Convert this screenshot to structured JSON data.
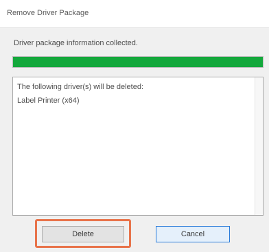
{
  "window": {
    "title": "Remove Driver Package"
  },
  "status": {
    "label": "Driver package information collected.",
    "progress_percent": 100,
    "progress_color": "#14a83c"
  },
  "list": {
    "lines": [
      "The following driver(s) will be deleted:",
      "Label Printer (x64)"
    ]
  },
  "buttons": {
    "delete_label": "Delete",
    "cancel_label": "Cancel"
  },
  "annotation": {
    "highlight_color": "#e8734a",
    "highlighted": "delete-button"
  }
}
